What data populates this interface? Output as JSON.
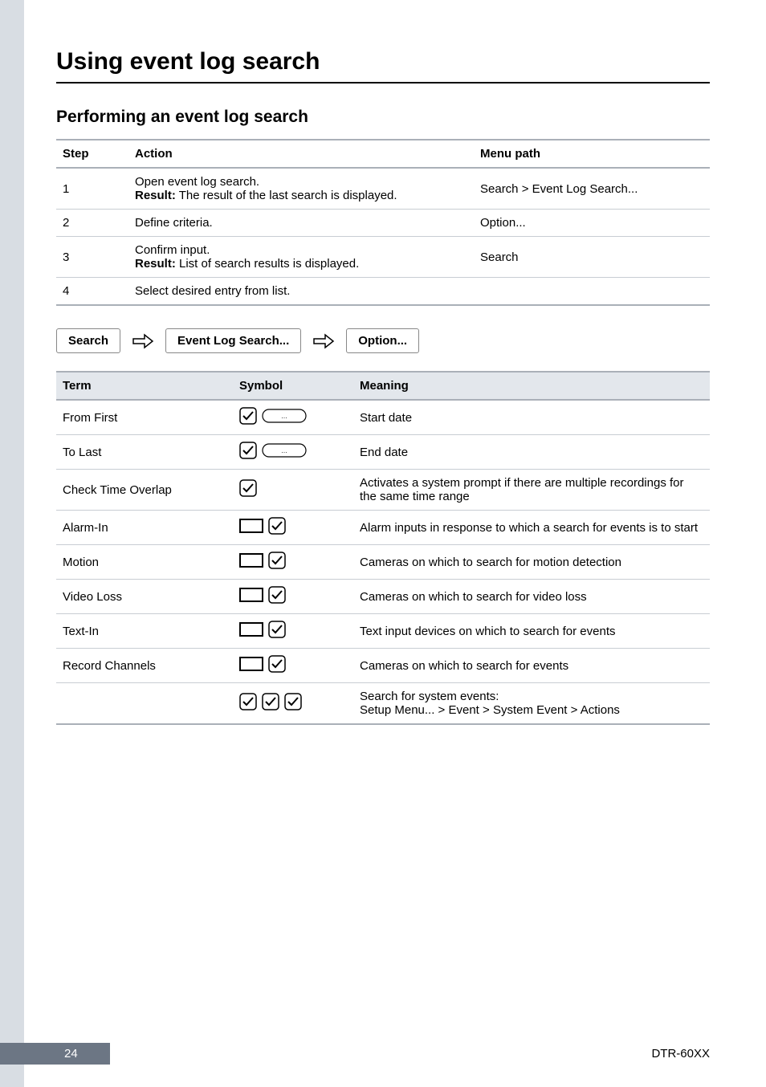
{
  "page": {
    "title": "Using event log search",
    "subtitle": "Performing an event log search"
  },
  "steps_table": {
    "headers": {
      "step": "Step",
      "action": "Action",
      "menu": "Menu path"
    },
    "rows": [
      {
        "step": "1",
        "action_line1": "Open event log search.",
        "result_label": "Result:",
        "result_text": " The result of the last search is displayed.",
        "menu": "Search > Event Log Search..."
      },
      {
        "step": "2",
        "action_line1": "Define criteria.",
        "result_label": "",
        "result_text": "",
        "menu": "Option..."
      },
      {
        "step": "3",
        "action_line1": "Confirm input.",
        "result_label": "Result:",
        "result_text": " List of search results is displayed.",
        "menu": "Search"
      },
      {
        "step": "4",
        "action_line1": "Select desired entry from list.",
        "result_label": "",
        "result_text": "",
        "menu": ""
      }
    ]
  },
  "breadcrumb": {
    "a": "Search",
    "b": "Event Log Search...",
    "c": "Option..."
  },
  "terms_table": {
    "headers": {
      "term": "Term",
      "symbol": "Symbol",
      "meaning": "Meaning"
    },
    "rows": {
      "from_first": {
        "term": "From First",
        "meaning": "Start date"
      },
      "to_last": {
        "term": "To Last",
        "meaning": "End date"
      },
      "overlap": {
        "term": "Check Time Overlap",
        "meaning": "Activates a system prompt if there are multiple recordings for the same time range"
      },
      "alarm_in": {
        "term": "Alarm-In",
        "meaning": "Alarm inputs in response to which a search for events is to start"
      },
      "motion": {
        "term": "Motion",
        "meaning": "Cameras on which to search for motion detection"
      },
      "video_loss": {
        "term": "Video Loss",
        "meaning": "Cameras on which to search for video loss"
      },
      "text_in": {
        "term": "Text-In",
        "meaning": "Text input devices on which to search for events"
      },
      "record_ch": {
        "term": "Record Channels",
        "meaning": "Cameras on which to search for events"
      },
      "sys_events": {
        "term": "",
        "meaning_line1": "Search for system events:",
        "meaning_line2": "Setup Menu... > Event > System Event > Actions"
      }
    }
  },
  "footer": {
    "page_number": "24",
    "model": "DTR-60XX"
  }
}
